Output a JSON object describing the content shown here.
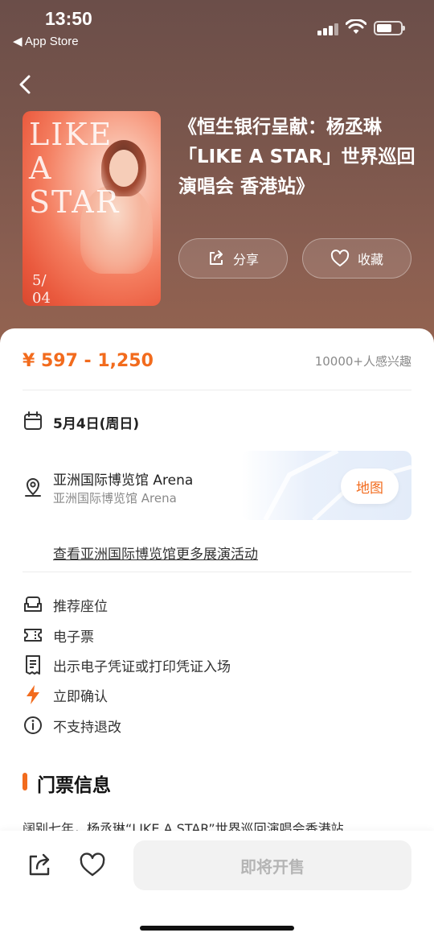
{
  "status_bar": {
    "time": "13:50",
    "back_app": "◀ App Store"
  },
  "hero": {
    "title": "《恒生银行呈献：杨丞琳「LIKE A STAR」世界巡回演唱会 香港站》",
    "share_label": "分享",
    "favorite_label": "收藏",
    "poster": {
      "letters": "LIKE\nA\nSTAR",
      "date": "5/\n04"
    }
  },
  "pricing": {
    "price": "¥ 597 - 1,250",
    "interest": "10000+人感兴趣"
  },
  "event": {
    "date": "5月4日(周日)",
    "venue_name": "亚洲国际博览馆 Arena",
    "venue_sub": "亚洲国际博览馆 Arena",
    "map_label": "地图",
    "more_link": "查看亚洲国际博览馆更多展演活动"
  },
  "features": [
    {
      "label": "推荐座位",
      "icon": "sofa-icon"
    },
    {
      "label": "电子票",
      "icon": "ticket-icon"
    },
    {
      "label": "出示电子凭证或打印凭证入场",
      "icon": "receipt-icon"
    },
    {
      "label": "立即确认",
      "icon": "lightning-icon"
    },
    {
      "label": "不支持退改",
      "icon": "info-icon"
    }
  ],
  "ticket_info": {
    "section_title": "门票信息",
    "intro": "阔别七年，杨丞琳“LIKE A STAR”世界巡回演唱会香港站"
  },
  "bottom_bar": {
    "buy_label": "即将开售"
  },
  "colors": {
    "accent": "#f26b1d",
    "hero_bg": "#7a564c"
  }
}
